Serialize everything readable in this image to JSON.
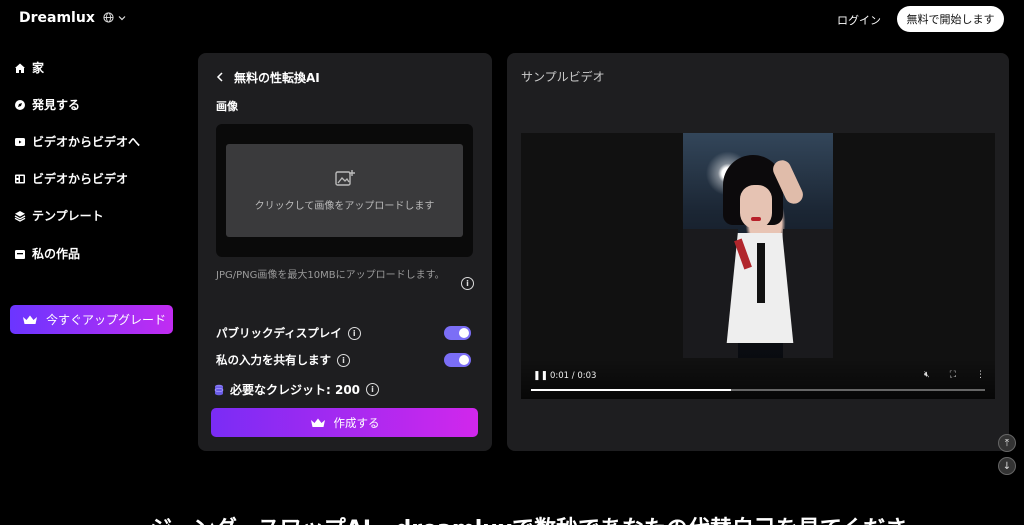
{
  "brand": "Dreamlux",
  "header": {
    "login": "ログイン",
    "start": "無料で開始します"
  },
  "sidebar": {
    "items": [
      {
        "label": "家",
        "icon": "home-icon"
      },
      {
        "label": "発見する",
        "icon": "compass-icon"
      },
      {
        "label": "ビデオからビデオへ",
        "icon": "video-icon"
      },
      {
        "label": "ビデオからビデオ",
        "icon": "film-icon"
      },
      {
        "label": "テンプレート",
        "icon": "layers-icon"
      },
      {
        "label": "私の作品",
        "icon": "folder-icon"
      }
    ],
    "upgrade": "今すぐアップグレード"
  },
  "tool": {
    "title": "無料の性転換AI",
    "image_label": "画像",
    "upload_text": "クリックして画像をアップロードします",
    "upload_hint": "JPG/PNG画像を最大10MBにアップロードします。",
    "public_display": "パブリックディスプレイ",
    "share_input": "私の入力を共有します",
    "credits": "必要なクレジット: 200",
    "create": "作成する"
  },
  "sample": {
    "title": "サンプルビデオ",
    "time": "0:01 / 0:03",
    "progress": 0.44
  },
  "bottom_heading": "ジーンダースワップAI - dreamluxで数秒であなたの代替自己を見てくださ"
}
